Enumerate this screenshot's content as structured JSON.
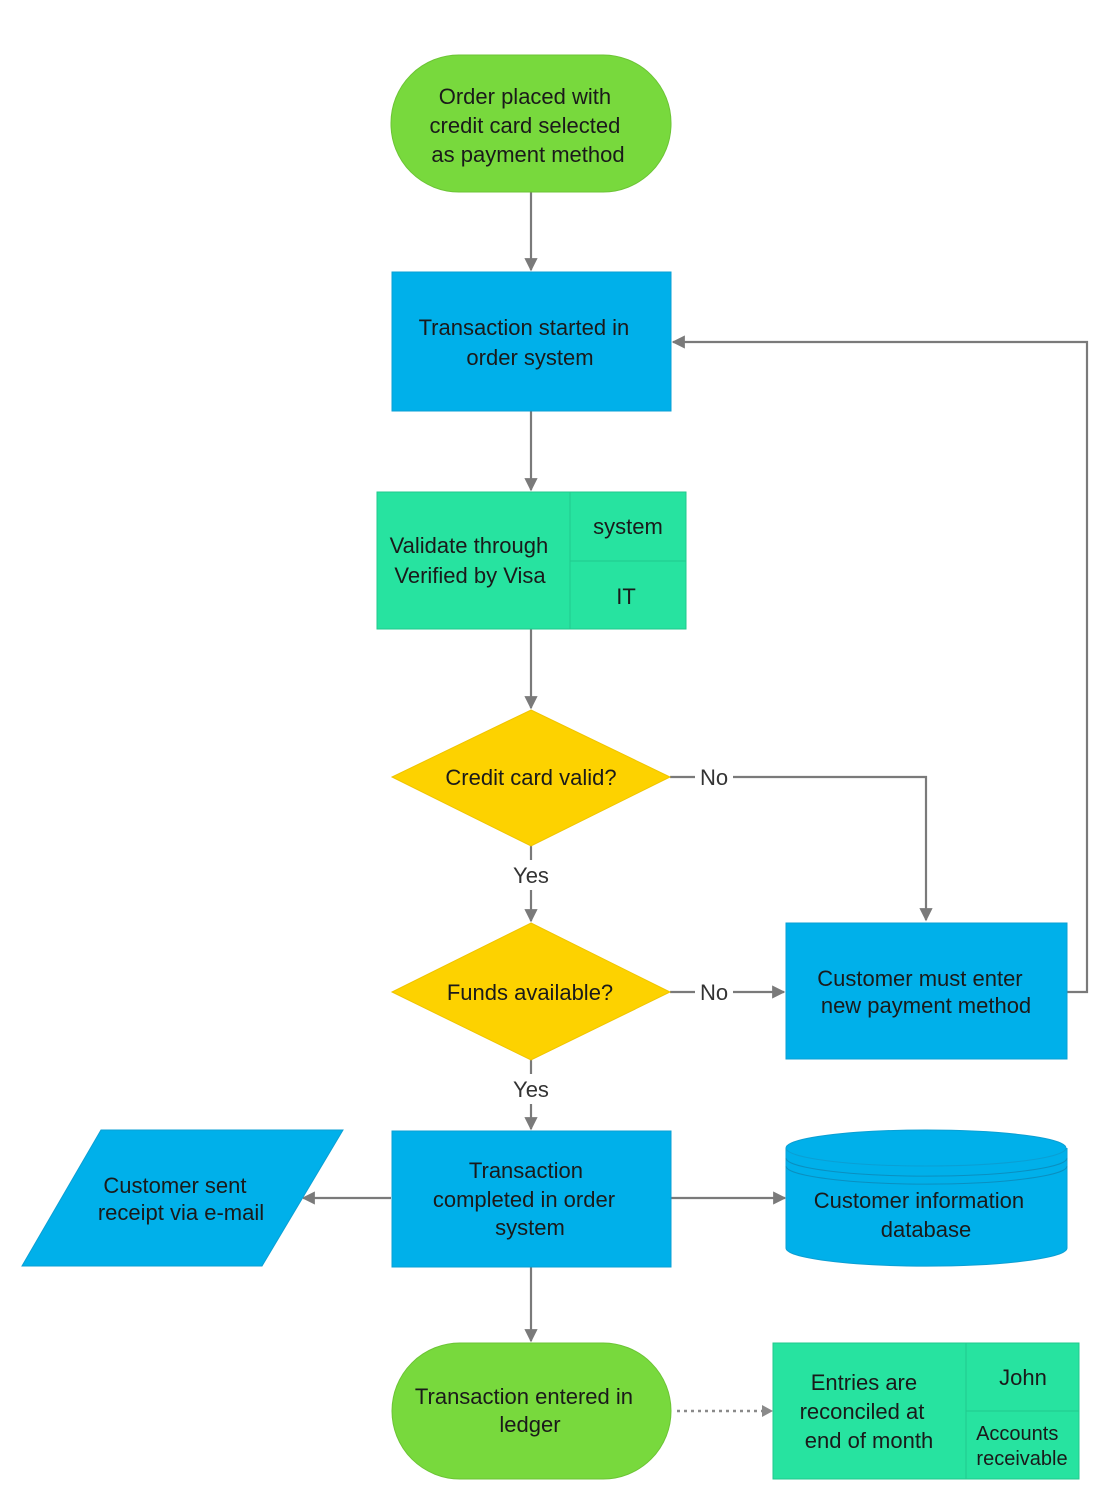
{
  "colors": {
    "terminator": "#78d93d",
    "process": "#00b0ea",
    "swimlane": "#27e3a0",
    "decision": "#fdd200",
    "connector": "#7a7a7a",
    "text": "#1a1a1a"
  },
  "nodes": {
    "start": {
      "lines": [
        "Order placed with",
        "credit card selected",
        "as payment method"
      ]
    },
    "txn_started": {
      "lines": [
        "Transaction started in",
        "order system"
      ]
    },
    "validate": {
      "lines": [
        "Validate through",
        "Verified by Visa"
      ],
      "cell_top": "system",
      "cell_bottom": "IT"
    },
    "cc_valid": {
      "lines": [
        "Credit card valid?"
      ]
    },
    "funds": {
      "lines": [
        "Funds available?"
      ]
    },
    "new_payment": {
      "lines": [
        "Customer must enter",
        "new payment method"
      ]
    },
    "txn_completed": {
      "lines": [
        "Transaction",
        "completed in order",
        "system"
      ]
    },
    "receipt": {
      "lines": [
        "Customer sent",
        "receipt via e-mail"
      ]
    },
    "database": {
      "lines": [
        "Customer information",
        "database"
      ]
    },
    "ledger": {
      "lines": [
        "Transaction entered in",
        "ledger"
      ]
    },
    "reconcile": {
      "lines": [
        "Entries are",
        "reconciled at",
        "end of month"
      ],
      "cell_top": "John",
      "cell_bottom": [
        "Accounts",
        "receivable"
      ]
    }
  },
  "edges": {
    "cc_no": "No",
    "cc_yes": "Yes",
    "funds_no": "No",
    "funds_yes": "Yes"
  }
}
